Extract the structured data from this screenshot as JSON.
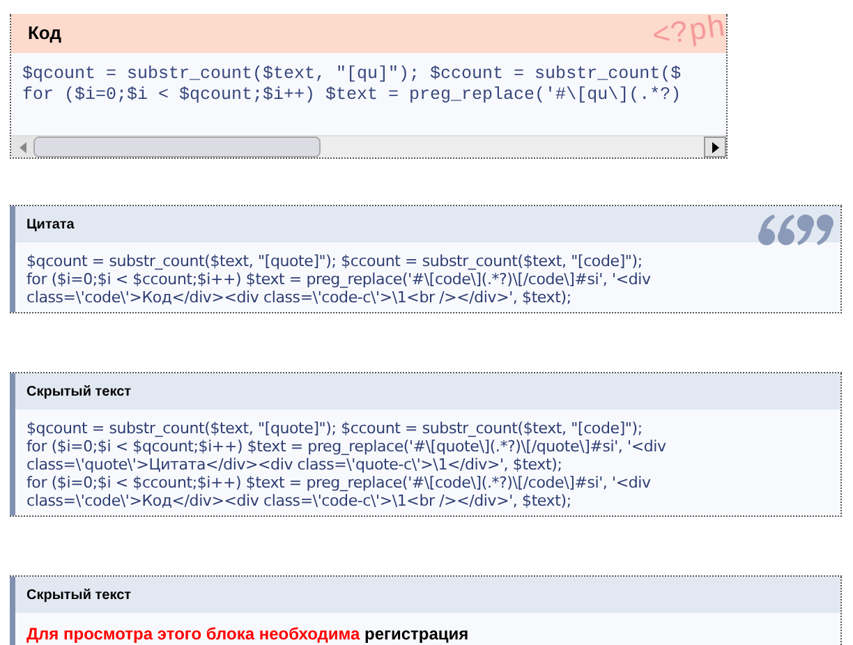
{
  "code_block": {
    "title": "Код",
    "language_mark": "<?ph",
    "lines": [
      "$qcount = substr_count($text, \"[qu]\"); $ccount = substr_count($",
      "for ($i=0;$i < $qcount;$i++) $text = preg_replace('#\\[qu\\](.*?)"
    ]
  },
  "blocks": [
    {
      "kind": "quote",
      "title": "Цитата",
      "lines": [
        "$qcount = substr_count($text, \"[quote]\"); $ccount = substr_count($text, \"[code]\");",
        "for ($i=0;$i < $ccount;$i++) $text = preg_replace('#\\[code\\](.*?)\\[/code\\]#si', '<div",
        "class=\\'code\\'>Код</div><div class=\\'code-c\\'>\\1<br /></div>', $text);"
      ]
    },
    {
      "kind": "hidden",
      "title": "Скрытый текст",
      "lines": [
        "$qcount = substr_count($text, \"[quote]\"); $ccount = substr_count($text, \"[code]\");",
        "for ($i=0;$i < $qcount;$i++) $text = preg_replace('#\\[quote\\](.*?)\\[/quote\\]#si', '<div",
        "class=\\'quote\\'>Цитата</div><div class=\\'quote-c\\'>\\1</div>', $text);",
        "for ($i=0;$i < $ccount;$i++) $text = preg_replace('#\\[code\\](.*?)\\[/code\\]#si', '<div",
        "class=\\'code\\'>Код</div><div class=\\'code-c\\'>\\1<br /></div>', $text);"
      ]
    },
    {
      "kind": "locked",
      "title": "Скрытый текст",
      "notice": "Для просмотра этого блока необходима",
      "link": "регистрация"
    }
  ]
}
